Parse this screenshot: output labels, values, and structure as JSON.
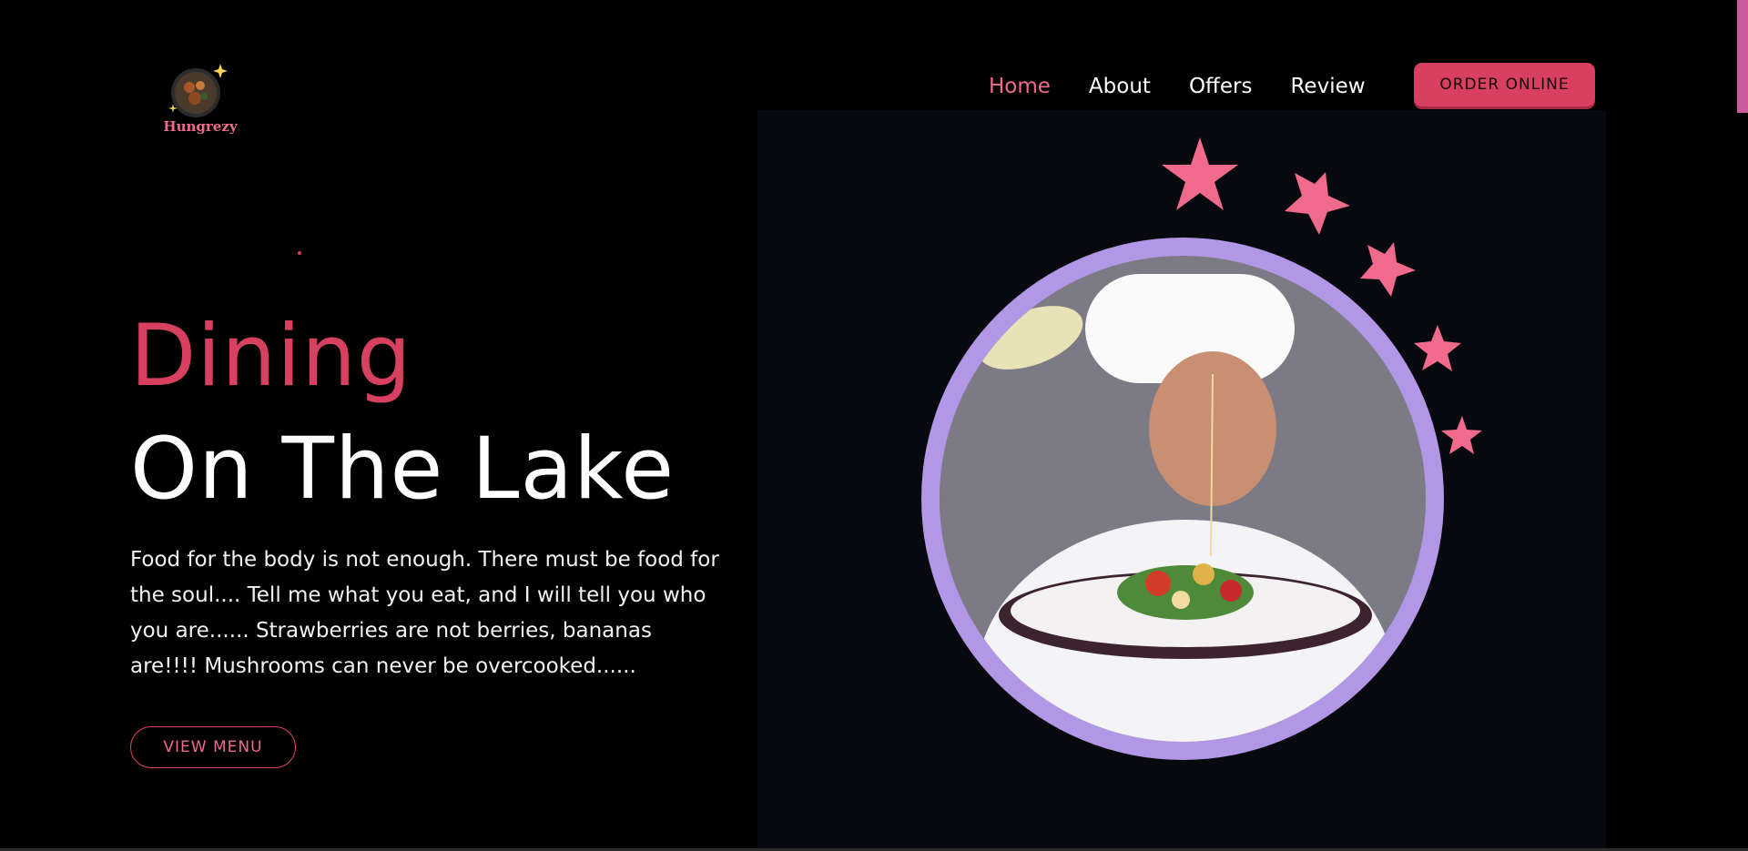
{
  "brand": {
    "name": "Hungrezy",
    "accent": "#d8405f",
    "accent_light": "#f06a8c",
    "ring": "#b197e6"
  },
  "nav": {
    "items": [
      {
        "label": "Home",
        "active": true
      },
      {
        "label": "About",
        "active": false
      },
      {
        "label": "Offers",
        "active": false
      },
      {
        "label": "Review",
        "active": false
      }
    ],
    "order_label": "ORDER ONLINE"
  },
  "hero": {
    "headline_1": "Dining",
    "headline_2": "On The Lake",
    "tagline": "Food for the body is not enough. There must be food for the soul.... Tell me what you eat, and I will tell you who you are...... Strawberries are not berries, bananas are!!!! Mushrooms can never be overcooked......",
    "cta_label": "VIEW MENU"
  },
  "hero_image": {
    "subject": "chef-plating-salad",
    "decorations": "star-icon"
  }
}
